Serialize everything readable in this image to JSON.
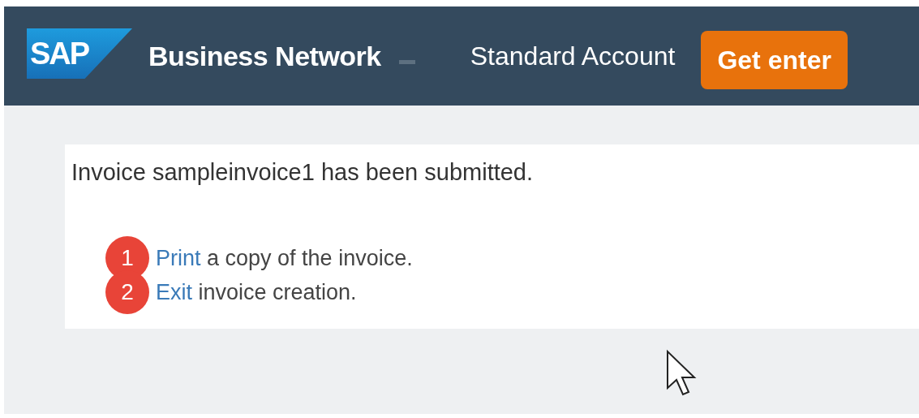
{
  "header": {
    "logo": "SAP",
    "title": "Business Network",
    "account": "Standard Account",
    "cta_button": "Get enter"
  },
  "confirmation": {
    "message": "Invoice sampleinvoice1 has been submitted.",
    "steps": [
      {
        "badge": "1",
        "link": "Print",
        "text": "a copy of the invoice."
      },
      {
        "badge": "2",
        "link": "Exit",
        "text": "invoice creation."
      }
    ]
  }
}
